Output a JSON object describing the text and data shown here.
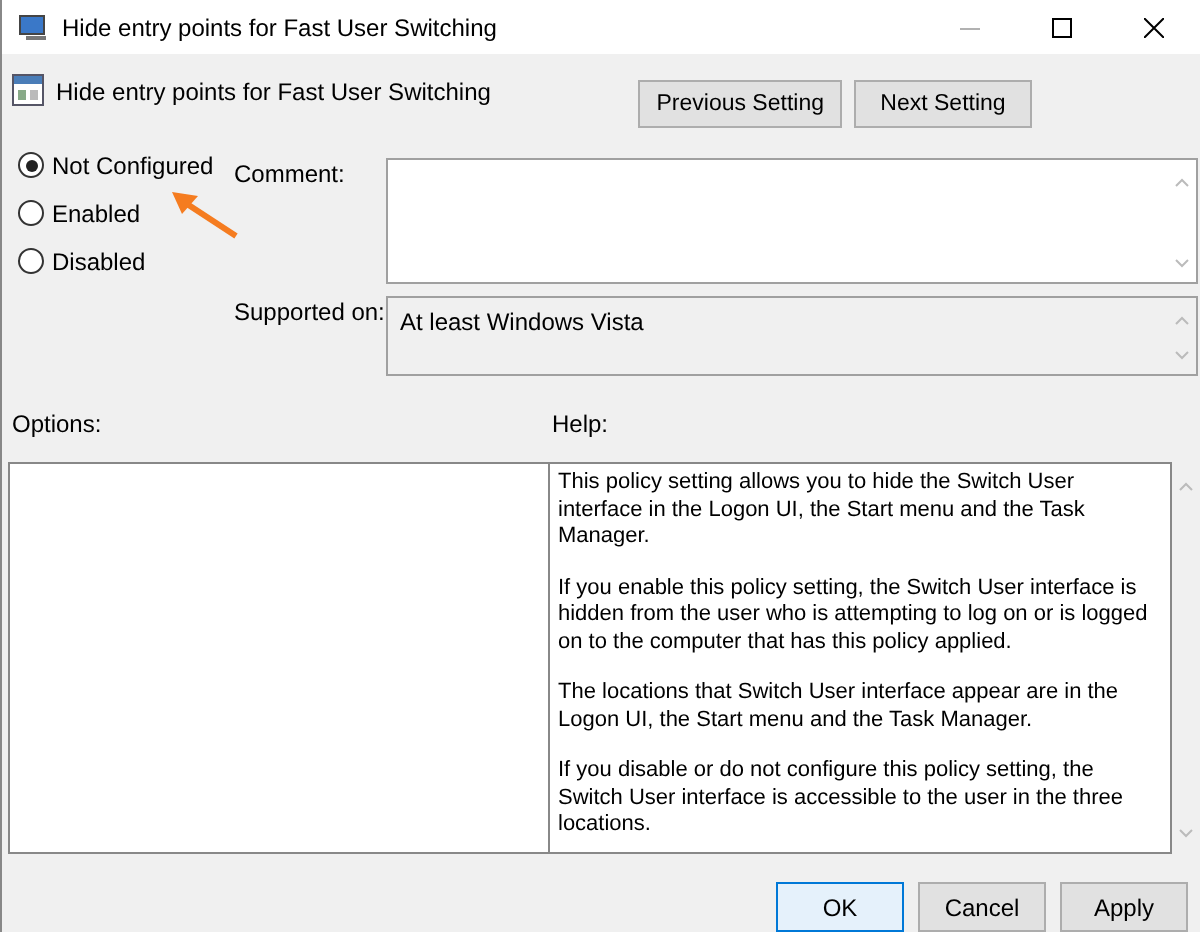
{
  "window": {
    "title": "Hide entry points for Fast User Switching",
    "minimize_disabled": true
  },
  "header": {
    "title": "Hide entry points for Fast User Switching",
    "buttons": [
      "Previous Setting",
      "Next Setting"
    ]
  },
  "state_options": [
    {
      "label": "Not Configured",
      "selected": true
    },
    {
      "label": "Enabled",
      "selected": false
    },
    {
      "label": "Disabled",
      "selected": false
    }
  ],
  "comment": {
    "label": "Comment:"
  },
  "supported_on": {
    "label": "Supported on:",
    "value": "At least Windows Vista"
  },
  "options": {
    "label": "Options:"
  },
  "help": {
    "label": "Help:",
    "paragraphs": [
      "This policy setting allows you to hide the Switch User interface in the Logon UI, the Start menu and the Task Manager.",
      "If you enable this policy setting, the Switch User interface is hidden from the user who is attempting to log on or is logged on to the computer that has this policy applied.",
      "The locations that Switch User interface appear are in the Logon UI, the Start menu and the Task Manager.",
      "If you disable or do not configure this policy setting, the Switch User interface is accessible to the user in the three locations."
    ]
  },
  "annotation": {
    "kind": "arrow",
    "color": "#f57c20"
  },
  "buttons": [
    {
      "label": "OK",
      "default": true
    },
    {
      "label": "Cancel",
      "default": false
    },
    {
      "label": "Apply",
      "default": false
    }
  ]
}
